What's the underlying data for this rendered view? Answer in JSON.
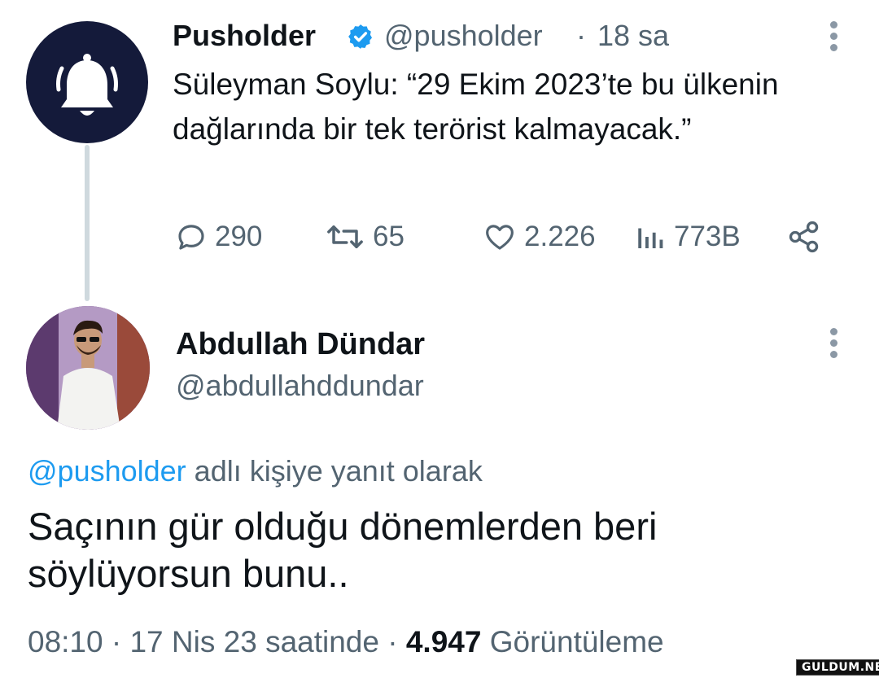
{
  "tweet1": {
    "name": "Pusholder",
    "handle": "@pusholder",
    "separator": "·",
    "time": "18 sa",
    "text": "Süleyman Soylu: “29 Ekim 2023’te bu ülkenin dağlarında bir tek terörist kalmayacak.”",
    "metrics": {
      "replies": "290",
      "retweets": "65",
      "likes": "2.226",
      "views": "773B"
    }
  },
  "tweet2": {
    "name": "Abdullah Dündar",
    "handle": "@abdullahddundar",
    "reply_mention": "@pusholder",
    "reply_suffix": " adlı kişiye yanıt olarak",
    "text": "Saçının gür olduğu dönemlerden beri söylüyorsun bunu..",
    "time": "08:10",
    "date": "17 Nis 23 saatinde",
    "views_count": "4.947",
    "views_label": "Görüntüleme"
  },
  "watermark": "GULDUM.NET",
  "colors": {
    "accent": "#1d9bf0",
    "secondary_text": "#536471",
    "avatar_bg": "#141a3a",
    "thread_line": "#cfd9de"
  }
}
